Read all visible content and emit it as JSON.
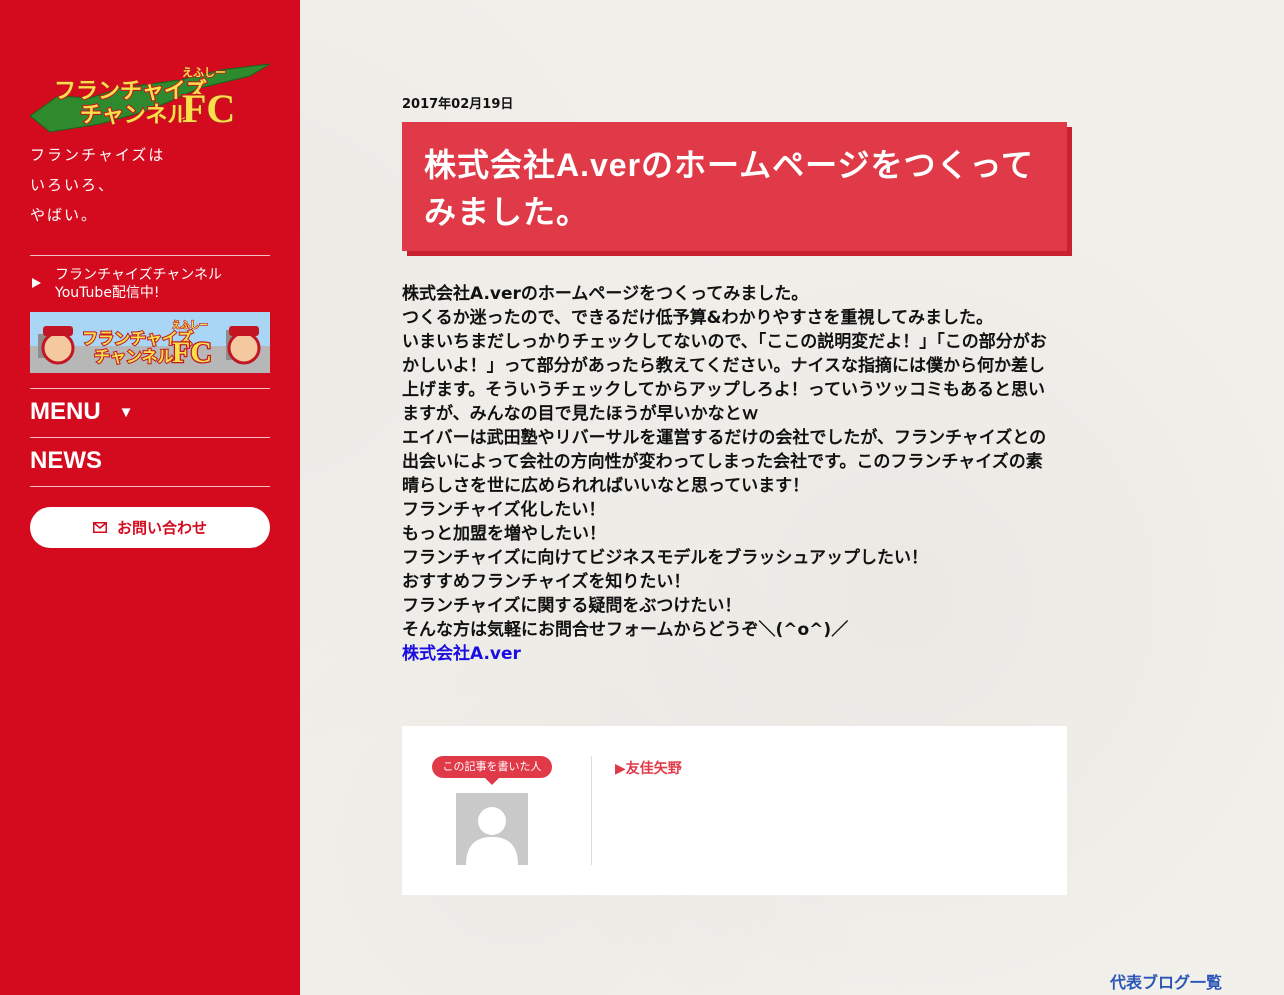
{
  "sidebar": {
    "logo": {
      "line1": "フランチャイズ",
      "line2": "チャンネル",
      "badge": "FC",
      "small": "えふしー"
    },
    "tagline": [
      "フランチャイズは",
      "いろいろ、",
      "やばい。"
    ],
    "youtube_link": {
      "line1": "フランチャイズチャンネル",
      "line2": "YouTube配信中!"
    },
    "banner": {
      "line1": "フランチャイズ",
      "line2": "チャンネル",
      "badge": "FC",
      "small": "えふしー"
    },
    "menu_label": "MENU",
    "menu_arrow": "▼",
    "news_label": "NEWS",
    "contact_label": "お問い合わせ"
  },
  "article": {
    "date": "2017年02月19日",
    "title": "株式会社A.verのホームページをつくってみました。",
    "paragraphs": [
      "株式会社A.verのホームページをつくってみました。",
      "つくるか迷ったので、できるだけ低予算&わかりやすさを重視してみました。",
      "いまいちまだしっかりチェックしてないので、「ここの説明変だよ！」「この部分がおかしいよ！」って部分があったら教えてください。ナイスな指摘には僕から何か差し上げます。そういうチェックしてからアップしろよ！っていうツッコミもあると思いますが、みんなの目で見たほうが早いかなとｗ",
      "エイバーは武田塾やリバーサルを運営するだけの会社でしたが、フランチャイズとの出会いによって会社の方向性が変わってしまった会社です。このフランチャイズの素晴らしさを世に広められればいいなと思っています！",
      "フランチャイズ化したい！",
      "もっと加盟を増やしたい！",
      "フランチャイズに向けてビジネスモデルをブラッシュアップしたい！",
      "おすすめフランチャイズを知りたい！",
      "フランチャイズに関する疑問をぶつけたい！",
      "そんな方は気軽にお問合せフォームからどうぞ＼(^o^)／"
    ],
    "link_text": "株式会社A.ver"
  },
  "author": {
    "badge": "この記事を書いた人",
    "name": "▶友佳矢野"
  },
  "footer": {
    "blog_list_link": "代表ブログ一覧"
  },
  "colors": {
    "sidebar_red": "#d40b1e",
    "title_red": "#e03a49",
    "link_blue": "#1a0ddf"
  }
}
